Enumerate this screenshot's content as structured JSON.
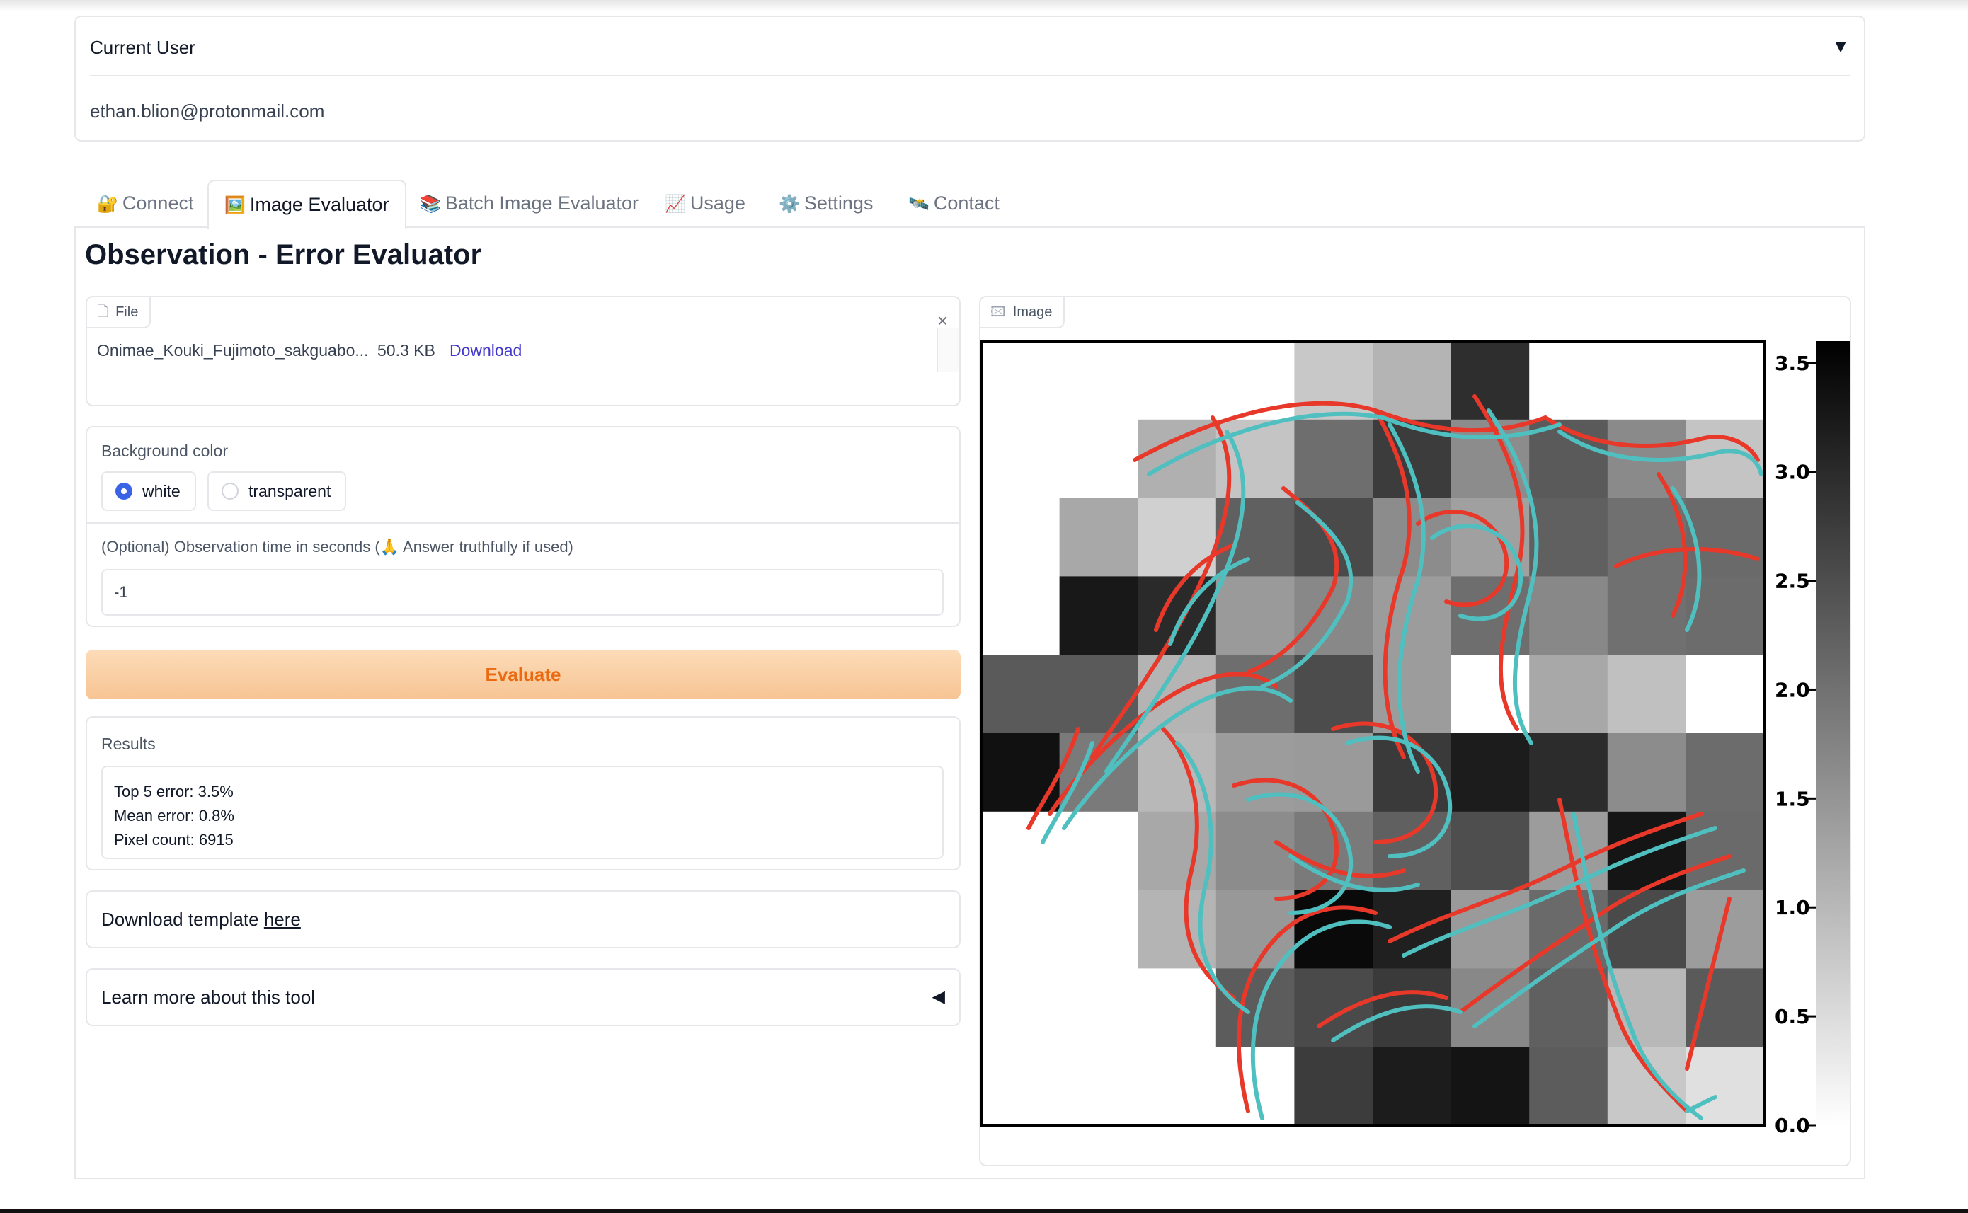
{
  "current_user": {
    "title": "Current User",
    "toggle": "▼",
    "email": "ethan.blion@protonmail.com"
  },
  "tabs": [
    {
      "icon": "🔐",
      "label": "Connect"
    },
    {
      "icon": "🖼️",
      "label": "Image Evaluator"
    },
    {
      "icon": "📚",
      "label": "Batch Image Evaluator"
    },
    {
      "icon": "📈",
      "label": "Usage"
    },
    {
      "icon": "⚙️",
      "label": "Settings"
    },
    {
      "icon": "🛰️",
      "label": "Contact"
    }
  ],
  "active_tab": "Image Evaluator",
  "page_title": "Observation - Error Evaluator",
  "file": {
    "label": "File",
    "name": "Onimae_Kouki_Fujimoto_sakguabo...",
    "size": "50.3 KB",
    "download": "Download",
    "close": "×"
  },
  "background": {
    "label": "Background color",
    "options": [
      "white",
      "transparent"
    ],
    "selected": "white"
  },
  "observation": {
    "label": "(Optional) Observation time in seconds (🙏 Answer truthfully if used)",
    "value": "-1"
  },
  "evaluate_label": "Evaluate",
  "results": {
    "label": "Results",
    "lines": [
      "Top 5 error: 3.5%",
      "Mean error: 0.8%",
      "Pixel count: 6915"
    ]
  },
  "template": {
    "text": "Download template ",
    "link": "here"
  },
  "learn": {
    "text": "Learn more about this tool",
    "toggle": "◀"
  },
  "image": {
    "label": "Image",
    "colorbar_ticks": [
      "0.0",
      "0.5",
      "1.0",
      "1.5",
      "2.0",
      "2.5",
      "3.0",
      "3.5"
    ],
    "colors": {
      "accent": "#3b63e6",
      "evaluate_text": "#ea6a12",
      "stroke_red": "#e8382a",
      "stroke_cyan": "#4fbfbf"
    }
  }
}
